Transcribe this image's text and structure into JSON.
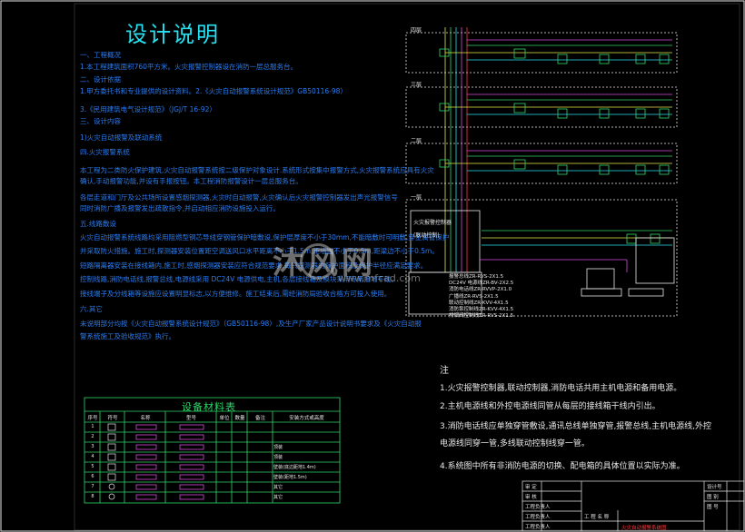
{
  "title": "设计说明",
  "spec_lines": [
    "一、工程概况",
    "1.本工程建筑面积760平方米。火灾报警控制器设在消防一层总服务台。",
    "二、设计依据",
    "1.甲方委托书和专业提供的设计资料。2.《火灾自动报警系统设计规范》GB50116-98）",
    "3.《民用建筑电气设计规范》（JGJ/T 16-92）",
    "三、设计内容",
    "1)火灾自动报警及联动系统",
    "四.火灾报警系统",
    "本工程为二类防火保护建筑,火灾自动报警系统按二级保护对象设计.系统形式按集中报警方式,火灾报警系统应具有火灾",
    "确认,手动报警功能,并设有手报按钮。本工程消防报警设计一层总服务台。",
    "各层走道和门厅及公共场所设置感烟探测器,火灾时自动报警,火灾确认后火灾报警控制器发出声光报警信号",
    "同时消防广播及报警发出疏散指令,并启动相应消防设施投入运行。",
    "五.线路敷设",
    "火灾自动报警系统线路均采用阻燃型铜芯导线穿钢管保护暗敷设,保护层厚度不小于30mm,不能暗敷时可明敷,穿金属管保护",
    "并采取防火措施。施工时,探测器安装位置距空调送风口水平距离不小于1.5m,距墙边不小于0.5m,距梁边不小于0.5m。",
    "短路隔离器安装在接线箱内,施工时,感烟探测器安装应符合规范要求,每只探测器的保护面积及保护半径应满足要求。",
    "控制线路,消防电话线,报警总线,电源线采用 DC24V 电源供电,主机,各层接线箱及模块采用专用接地干线。",
    "接线端子及分线箱等设施应设置明显标志,以方便维修。施工结束后,需经消防局验收合格方可投入使用。",
    "六.其它",
    "未说明部分均按《火灾自动报警系统设计规范》（GB50116-98）,及生产厂家产品设计说明书要求及《火灾自动报",
    "警系统施工及验收规范》执行。"
  ],
  "floors": [
    "四层",
    "三层",
    "二层",
    "一层"
  ],
  "panel": {
    "title": "火灾报警控制器",
    "subtitle": "(联动控制)"
  },
  "cable_legend": [
    "报警总线ZR-RVS-2X1.5",
    "DC24V 电源线ZR-BV-2X2.5",
    "消防电话线ZR-RVVP-2X1.0",
    "广播线ZR-RVS-2X1.5",
    "联动控制线ZR-KVV-4X1.5",
    "消防泵控制线ZR-KVV-4X1.5",
    "排烟阀控制线ZR-RVS-2X1.5"
  ],
  "materials_table": {
    "title": "设备材料表",
    "headers": [
      "序号",
      "符号",
      "名称",
      "型号",
      "单位",
      "数量",
      "备注",
      "安装方式或高度"
    ],
    "rows": [
      [
        "1",
        "",
        "",
        "",
        "",
        "",
        "",
        ""
      ],
      [
        "2",
        "",
        "",
        "",
        "",
        "",
        "",
        ""
      ],
      [
        "3",
        "",
        "",
        "",
        "",
        "",
        "",
        "顶装"
      ],
      [
        "4",
        "",
        "",
        "",
        "",
        "",
        "",
        "顶装"
      ],
      [
        "5",
        "",
        "",
        "",
        "",
        "",
        "",
        "壁装(底边距地1.4m)"
      ],
      [
        "6",
        "",
        "",
        "",
        "",
        "",
        "",
        "壁装(距地1.5m)"
      ],
      [
        "7",
        "",
        "",
        "",
        "",
        "",
        "",
        "其它"
      ],
      [
        "8",
        "",
        "",
        "",
        "",
        "",
        "",
        "其它"
      ]
    ]
  },
  "notes_title": "注",
  "notes": [
    "1.火灾报警控制器,联动控制器,消防电话共用主机电源和备用电源。",
    "2.主机电源线和外控电源线同管从每层的接线箱干线内引出。",
    "3.消防电话线应单独穿管敷设,通讯总线单独穿管,报警总线,主机电源线,外控",
    "电源线同穿一管,多线联动控制线穿一管。",
    "4.系统图中所有非消防电源的切换、配电箱的具体位置以实际为准。"
  ],
  "watermark": {
    "brand": "沐风网",
    "url": "www.mfcad.com"
  },
  "title_block": {
    "rows": [
      "审 定",
      "审 核",
      "工程负责人",
      "工程负责人",
      "工程负责人"
    ],
    "project_label": "工 程 名 称",
    "drawing_name": "火灾自动报警系统图",
    "right_labels": [
      "设计号",
      "图 别",
      "图 号"
    ]
  },
  "colors": {
    "background": "#000000",
    "title_cyan": "#27e0f0",
    "spec_blue": "#2a7cf0",
    "frame_green": "#2fd86a",
    "red": "#ff3b3b",
    "yellow": "#e8e84a",
    "magenta": "#d84ad8"
  }
}
